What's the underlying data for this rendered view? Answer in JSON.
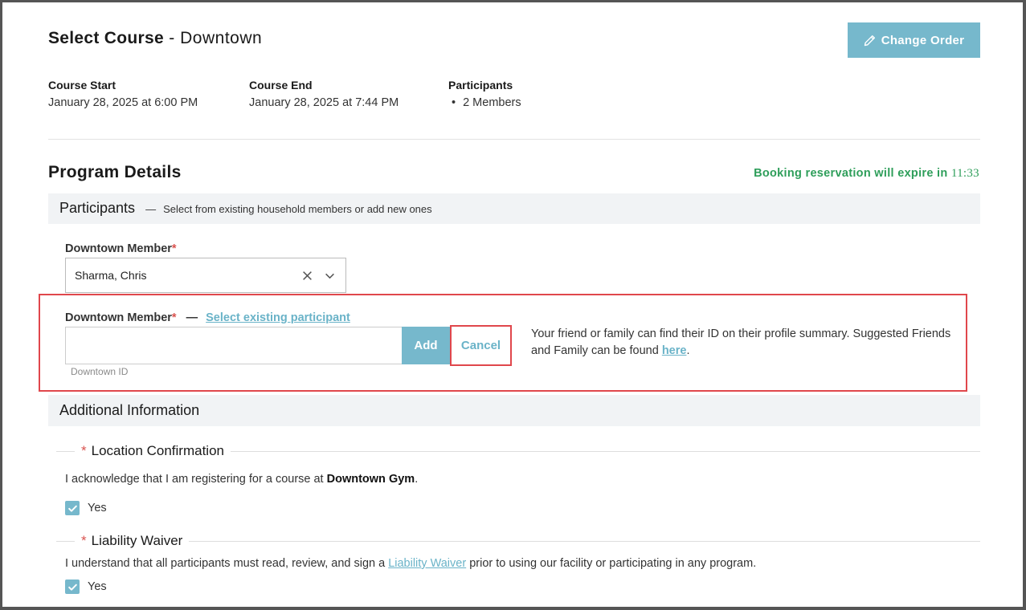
{
  "header": {
    "title_bold": "Select Course",
    "title_sep": " - ",
    "title_location": "Downtown",
    "change_order_label": "Change Order"
  },
  "course_info": {
    "start_label": "Course Start",
    "start_value": "January 28, 2025 at 6:00 PM",
    "end_label": "Course End",
    "end_value": "January 28, 2025 at 7:44 PM",
    "participants_label": "Participants",
    "participants_items": [
      "2 Members"
    ]
  },
  "program": {
    "title": "Program Details",
    "expire_text": "Booking reservation will expire in ",
    "expire_time": "11:33"
  },
  "participants_section": {
    "title": "Participants",
    "dash": "—",
    "subtitle": "Select from existing household members or add new ones",
    "member_label": "Downtown Member",
    "required_mark": "*",
    "selected_member": "Sharma, Chris",
    "new_member_label": "Downtown Member",
    "new_member_dash": "—",
    "select_existing_link": "Select existing participant",
    "id_input_value": "",
    "add_label": "Add",
    "cancel_label": "Cancel",
    "id_hint": "Downtown ID",
    "help_text_before": "Your friend or family can find their ID on their profile summary. Suggested Friends and Family can be found ",
    "help_link": "here",
    "help_text_after": "."
  },
  "additional_section": {
    "title": "Additional Information",
    "location": {
      "required_mark": "*",
      "legend": "Location Confirmation",
      "text_before": "I acknowledge that I am registering for a course at ",
      "text_bold": "Downtown Gym",
      "text_after": ".",
      "checkbox_label": "Yes",
      "checked": true
    },
    "waiver": {
      "required_mark": "*",
      "legend": "Liability Waiver",
      "text_before": "I understand that all participants must read, review, and sign a ",
      "link": "Liability Waiver",
      "text_after": " prior to using our facility or participating in any program.",
      "checkbox_label": "Yes",
      "checked": true
    }
  },
  "colors": {
    "accent": "#76b8cc",
    "link": "#6ab3c8",
    "success": "#2e9e5a",
    "required": "#d9534f",
    "highlight": "#e0474c"
  },
  "icons": [
    "pencil-icon",
    "clear-icon",
    "chevron-down-icon",
    "check-icon"
  ]
}
